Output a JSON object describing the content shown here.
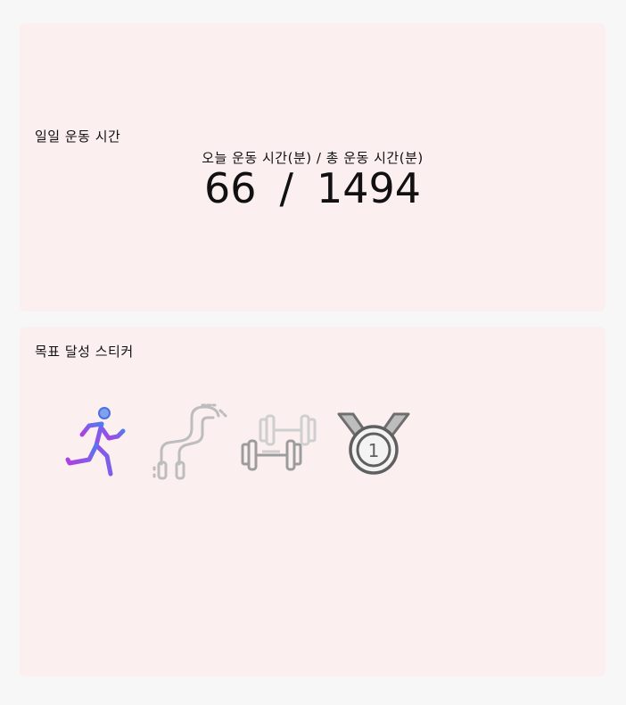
{
  "daily_card": {
    "title": "일일 운동 시간",
    "caption": "오늘 운동 시간(분) / 총 운동 시간(분)",
    "today_minutes": "66",
    "separator": "/",
    "total_minutes": "1494"
  },
  "sticker_card": {
    "title": "목표 달성 스티커",
    "stickers": [
      {
        "icon": "running-person-icon",
        "achieved": true
      },
      {
        "icon": "jump-rope-icon",
        "achieved": false
      },
      {
        "icon": "dumbbells-icon",
        "achieved": false
      },
      {
        "icon": "medal-icon",
        "achieved": false
      }
    ]
  },
  "colors": {
    "background": "#f7f7f7",
    "card": "#fbeff0",
    "active_gradient_start": "#4f7bf0",
    "active_gradient_end": "#b23ee0",
    "inactive_icon": "#bdbdbd"
  }
}
